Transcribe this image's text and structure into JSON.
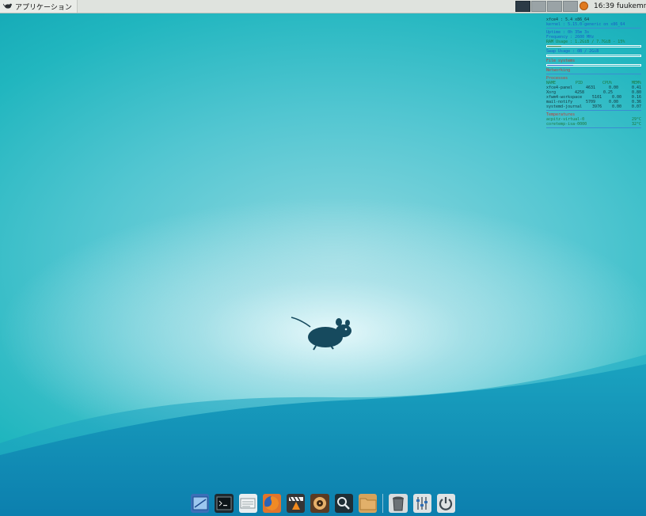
{
  "colors": {
    "desktop_light": "#8fd8e0",
    "desktop_mid": "#21b6bf",
    "desktop_dark": "#0f86b0",
    "panel_bg": "#dfe3de",
    "conky_blue": "#1a5ec7",
    "conky_red": "#c23a34",
    "mouse_color": "#164a5e"
  },
  "top_panel": {
    "app_menu_label": "アプリケーション",
    "app_menu_icon": "xfce-mouse-icon",
    "workspaces": [
      {
        "active": true
      },
      {
        "active": false
      },
      {
        "active": false
      },
      {
        "active": false
      }
    ],
    "tray_icon": "update-notifier-icon",
    "clock": "16:39",
    "user": "fuukemn"
  },
  "conky": {
    "lines": [
      "xfce4 : 5.4 x86_64",
      "kernel : 5.15.0-generic on x86_64",
      "Uptime : 0h 35m 3s",
      "Frequency : 2600 MHz",
      "RAM Usage : 1.2GiB / 7.7GiB - 15%",
      "Swap Usage : 0B / 2GiB",
      "File systems",
      "Networking",
      "Processes"
    ],
    "ram_percent": 15,
    "swap_percent": 0,
    "fs_percent": 28,
    "processes_header": [
      "NAME",
      "PID",
      "CPU%",
      "MEM%"
    ],
    "processes": [
      [
        "xfce4-panel",
        "4631",
        "0.00",
        "0.41"
      ],
      [
        "Xorg",
        "4258",
        "0.25",
        "0.80"
      ],
      [
        "xfwm4-workspace",
        "5101",
        "0.00",
        "0.16"
      ],
      [
        "mail-notify",
        "5709",
        "0.00",
        "0.36"
      ],
      [
        "systemd-journal",
        "3976",
        "0.00",
        "0.07"
      ]
    ],
    "temps_header": "Temperatures",
    "temps": [
      [
        "acpitz-virtual-0",
        "29°C"
      ],
      [
        "coretemp-isa-0000",
        "32°C"
      ]
    ]
  },
  "dock": {
    "items": [
      {
        "icon": "show-desktop-icon",
        "bg": "#3b6fb8"
      },
      {
        "icon": "terminal-icon",
        "bg": "#1e2a30"
      },
      {
        "icon": "mail-reader-icon",
        "bg": "#e9eef0"
      },
      {
        "icon": "firefox-icon",
        "bg": "#e2742a"
      },
      {
        "icon": "media-player-icon",
        "bg": "#353535"
      },
      {
        "icon": "audio-player-icon",
        "bg": "#5b3b22"
      },
      {
        "icon": "app-finder-icon",
        "bg": "#1f2f36"
      },
      {
        "icon": "file-manager-icon",
        "bg": "#d6a35b"
      },
      {
        "icon": "trash-icon",
        "bg": "#d8dcdd"
      },
      {
        "icon": "settings-manager-icon",
        "bg": "#dfe3e4"
      },
      {
        "icon": "logout-icon",
        "bg": "#dfe3e4"
      }
    ]
  }
}
